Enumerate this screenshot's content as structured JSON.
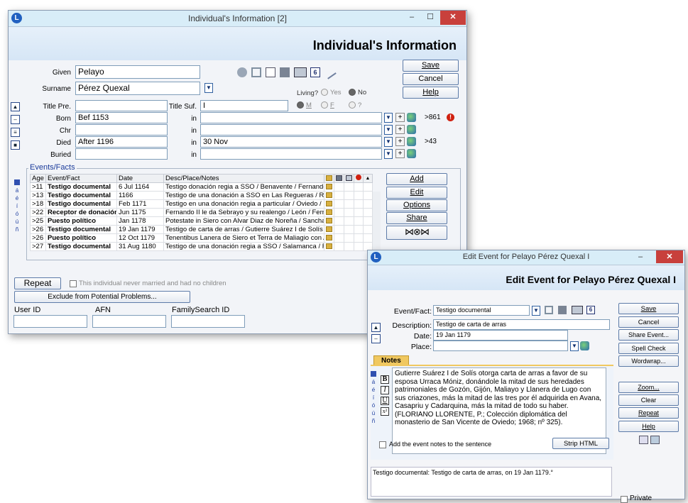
{
  "main_window": {
    "title": "Individual's Information  [2]",
    "heading": "Individual's Information",
    "buttons": {
      "save": "Save",
      "cancel": "Cancel",
      "help": "Help"
    },
    "labels": {
      "given": "Given",
      "surname": "Surname",
      "title_pre": "Title Pre.",
      "title_suf": "Title Suf.",
      "born": "Born",
      "chr": "Chr",
      "died": "Died",
      "buried": "Buried",
      "in": "in"
    },
    "given": "Pelayo",
    "surname": "Pérez Quexal",
    "title_pre": "",
    "title_suf": "I",
    "living": {
      "label": "Living?",
      "yes": "Yes",
      "no": "No",
      "selected": "No"
    },
    "sex": {
      "m": "M",
      "f": "F",
      "unknown": "?",
      "selected": "M"
    },
    "born": {
      "date": "Bef 1153",
      "place": "",
      "age": ">861"
    },
    "chr": {
      "date": "",
      "place": ""
    },
    "died": {
      "date": "After 1196",
      "place": "30 Nov",
      "age": ">43"
    },
    "buried": {
      "date": "",
      "place": ""
    },
    "events_label": "Events/Facts",
    "events_columns": [
      "Age",
      "Event/Fact",
      "Date",
      "Desc/Place/Notes"
    ],
    "events": [
      {
        "age": ">11",
        "event": "Testigo documental",
        "date": "6 Jul 1164",
        "desc": "Testigo donación regia a SSO / Benavente / Fernando II"
      },
      {
        "age": ">13",
        "event": "Testigo documental",
        "date": "1166",
        "desc": "Testigo de una donación a SSO en Las Regueras / Rodr"
      },
      {
        "age": ">18",
        "event": "Testigo documental",
        "date": "Feb 1171",
        "desc": "Testigo en una donación regia a particular / Oviedo / Fer"
      },
      {
        "age": ">22",
        "event": "Receptor de donación",
        "date": "Jun 1175",
        "desc": "Fernando II le da Sebrayo y su realengo / León / Fernan"
      },
      {
        "age": ">25",
        "event": "Puesto político",
        "date": "Jan 1178",
        "desc": "Potestate in Siero con Alvar Diaz de Noreña / Sancha Gc"
      },
      {
        "age": ">26",
        "event": "Testigo documental",
        "date": "19 Jan 1179",
        "desc": "Testigo de carta de arras / Gutierre Suárez I de Solís oto"
      },
      {
        "age": ">26",
        "event": "Puesto político",
        "date": "12 Oct 1179",
        "desc": "Tenentibus Lanera de Siero et Terra de Maliagio con Alva"
      },
      {
        "age": ">27",
        "event": "Testigo documental",
        "date": "31 Aug 1180",
        "desc": "Testigo de una donación regia a SSO / Salamanca / Fern"
      }
    ],
    "event_buttons": {
      "add": "Add",
      "edit": "Edit",
      "options": "Options",
      "share": "Share"
    },
    "side_chars": [
      "á",
      "é",
      "í",
      "ó",
      "ú",
      "ñ"
    ],
    "repeat": "Repeat",
    "never_married": "This individual never married and had no children",
    "exclude": "Exclude from Potential Problems...",
    "user_id_label": "User ID",
    "afn_label": "AFN",
    "familysearch_label": "FamilySearch ID"
  },
  "edit_window": {
    "title": "Edit Event for Pelayo Pérez Quexal I",
    "heading": "Edit Event for Pelayo Pérez Quexal I",
    "labels": {
      "event_fact": "Event/Fact:",
      "description": "Description:",
      "date": "Date:",
      "place": "Place:"
    },
    "event_fact": "Testigo documental",
    "description": "Testigo de carta de arras",
    "date": "19 Jan 1179",
    "place": "",
    "notes_tab": "Notes",
    "notes_text": "Gutierre Suárez I de Solís otorga carta de arras a favor de su esposa Urraca Móniz, donándole la mitad de sus heredades patrimoniales de Gozón, Gijón, Maliayo y Llanera de Lugo con sus criazones, más la mitad de las tres por él adquirida en Avana, Casapriu y Cadarquina, más la mitad de todo su haber. (FLORIANO LLORENTE, P.; Colección diplomática del monasterio de San Vicente de Oviedo; 1968; nº 325).",
    "add_notes_label": "Add the event notes to the sentence",
    "strip_html": "Strip HTML",
    "sentence": "Testigo documental: Testigo de carta de arras, on 19 Jan 1179.°",
    "buttons": {
      "save": "Save",
      "cancel": "Cancel",
      "share_event": "Share Event...",
      "spell_check": "Spell Check",
      "wordwrap": "Wordwrap...",
      "zoom": "Zoom...",
      "clear": "Clear",
      "repeat": "Repeat",
      "help": "Help"
    },
    "private_label": "Private",
    "format_buttons": [
      "B",
      "I",
      "U",
      "x²"
    ],
    "side_chars": [
      "á",
      "é",
      "í",
      "ó",
      "ú",
      "ñ"
    ]
  }
}
